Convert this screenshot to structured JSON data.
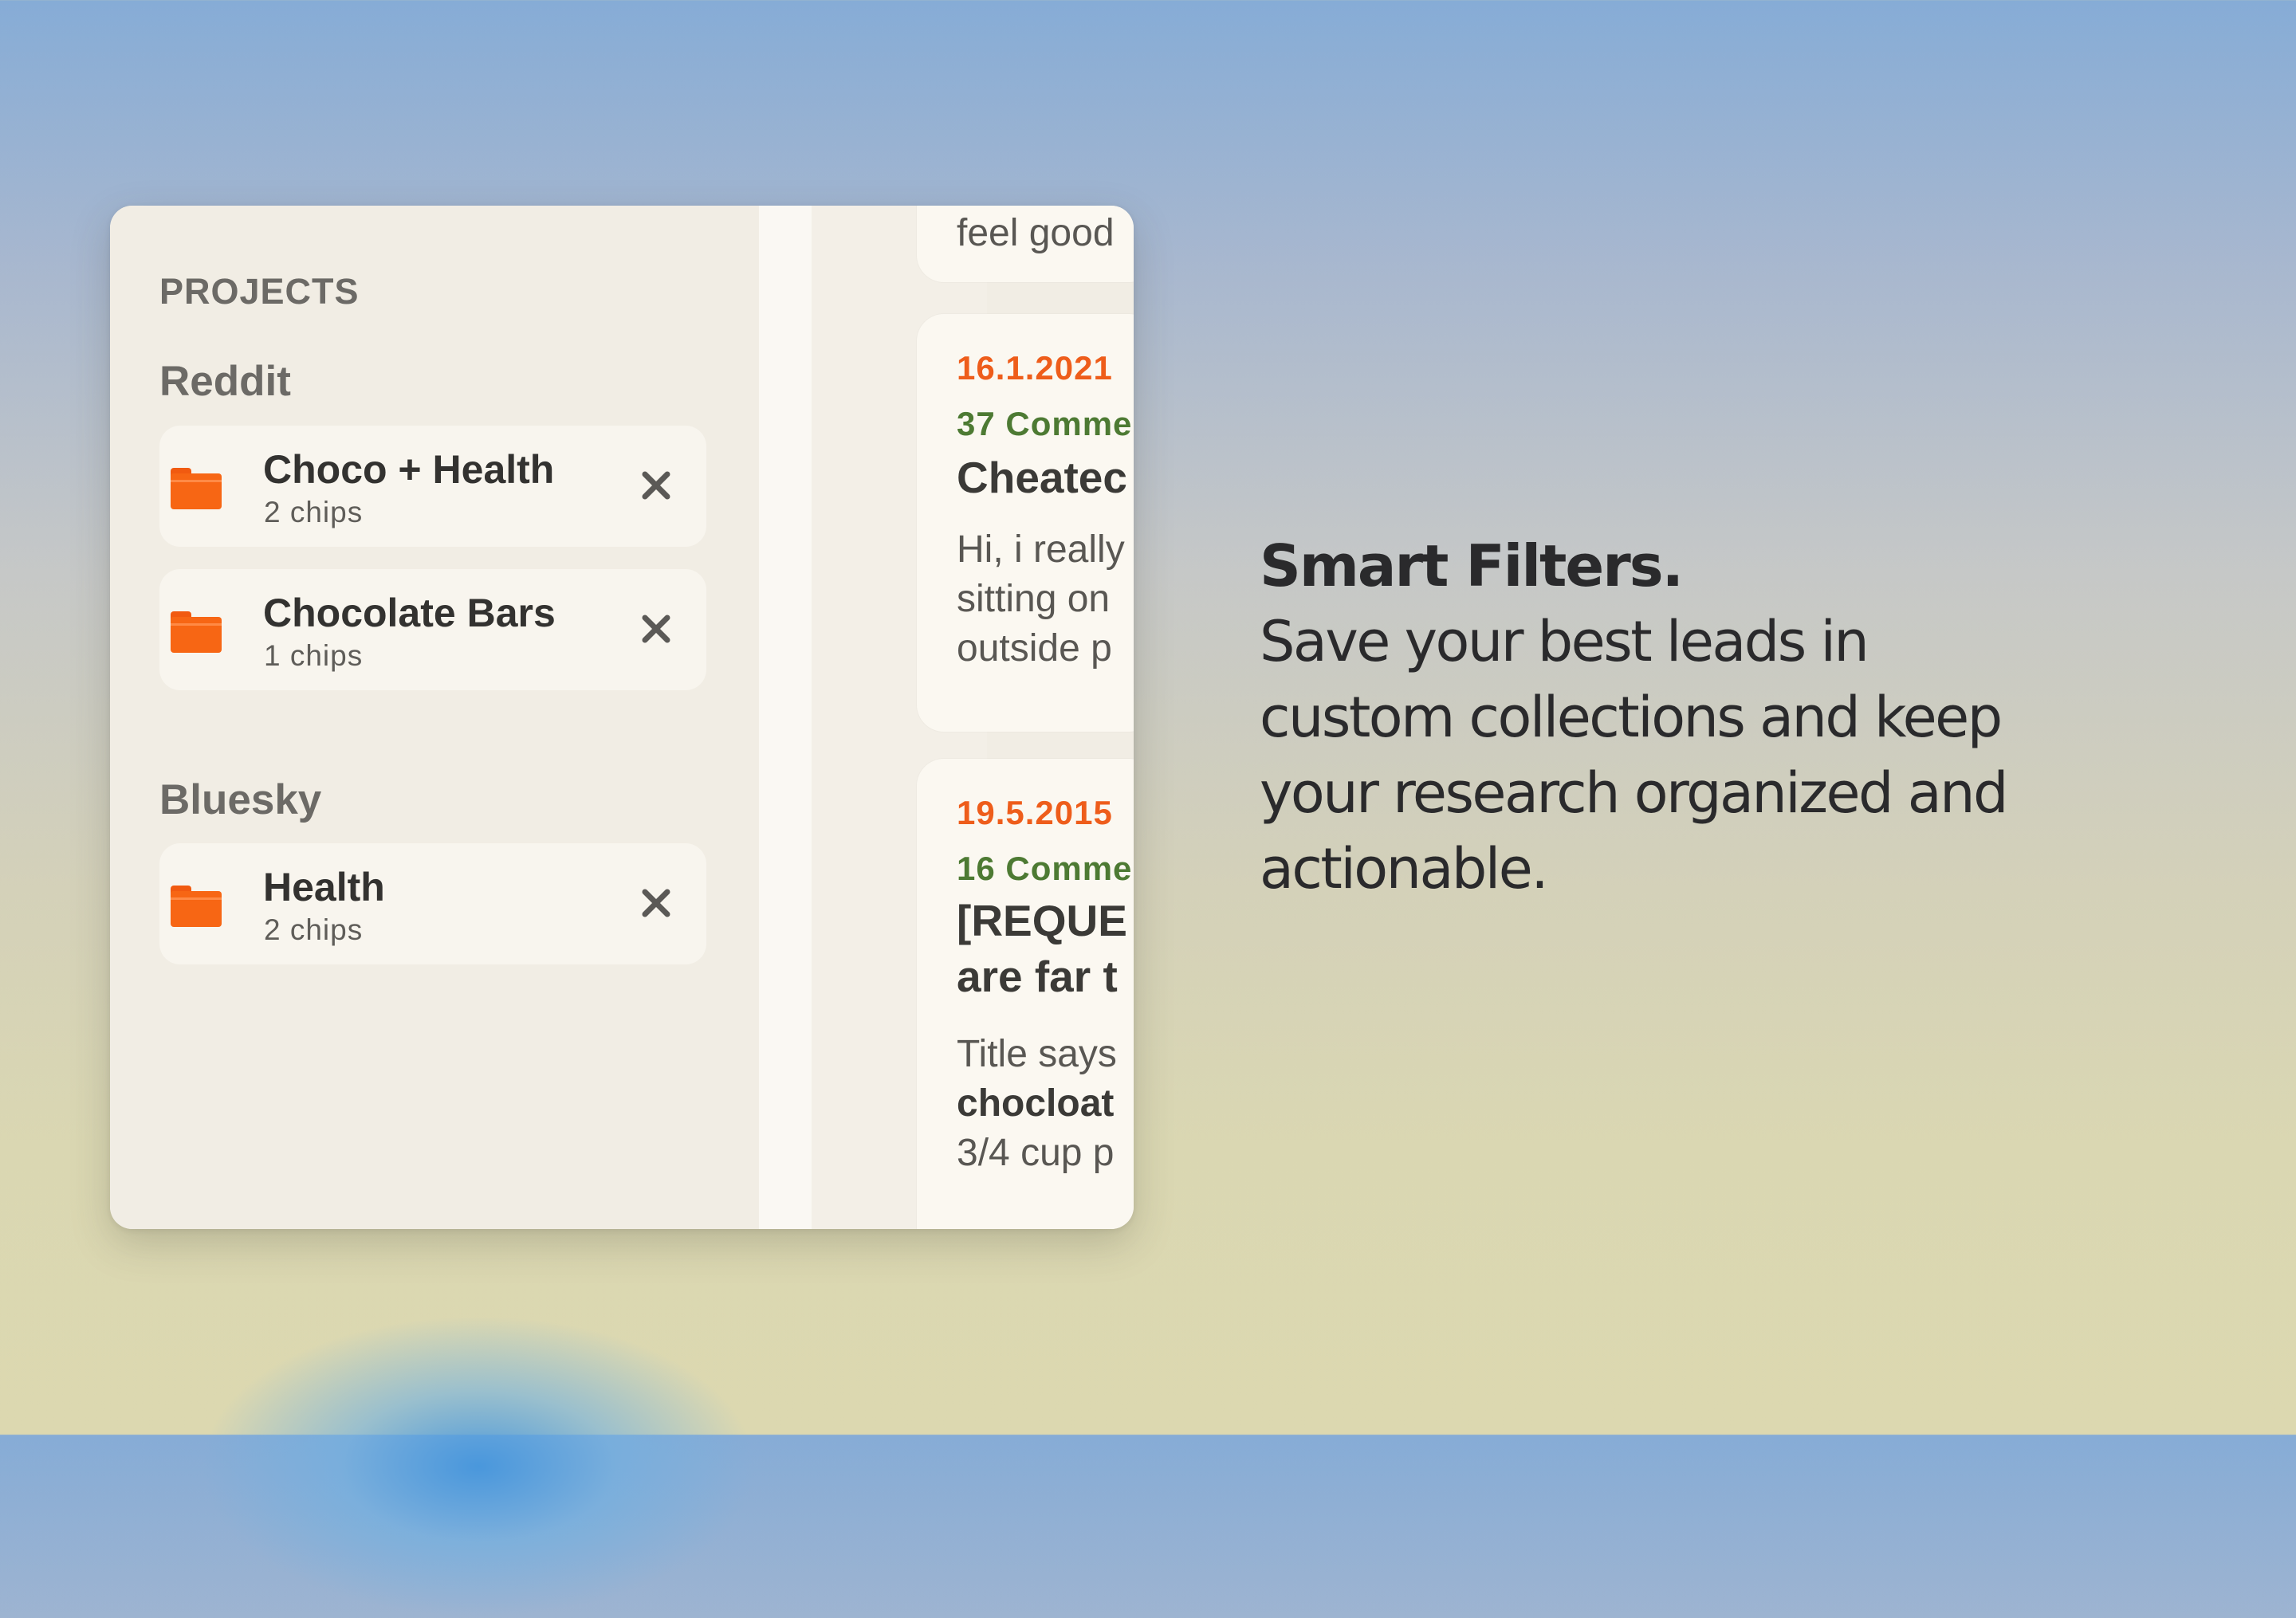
{
  "sidebar": {
    "heading": "PROJECTS",
    "groups": [
      {
        "title": "Reddit",
        "items": [
          {
            "name": "Choco + Health",
            "count": "2 chips",
            "icon": "folder-icon",
            "remove_icon": "close-icon"
          },
          {
            "name": "Chocolate Bars",
            "count": "1 chips",
            "icon": "folder-icon",
            "remove_icon": "close-icon"
          }
        ]
      },
      {
        "title": "Bluesky",
        "items": [
          {
            "name": "Health",
            "count": "2 chips",
            "icon": "folder-icon",
            "remove_icon": "close-icon"
          }
        ]
      }
    ]
  },
  "feed": {
    "cards": [
      {
        "snippet_tail": "feel good"
      },
      {
        "date": "16.1.2021",
        "comments": "37 Comme",
        "title": "Cheatec",
        "snippet": [
          "Hi, i really",
          "sitting on",
          "outside p"
        ]
      },
      {
        "date": "19.5.2015",
        "comments": "16 Comme",
        "title": [
          "[REQUE",
          "are far t"
        ],
        "snippet": [
          "Title says",
          "chocloat",
          "3/4 cup p"
        ]
      }
    ]
  },
  "marketing": {
    "headline": "Smart Filters.",
    "description": "Save your best leads in custom collections and keep your research organized and actionable."
  },
  "colors": {
    "folder": "#f76614",
    "date": "#ee5d1b",
    "comments": "#4d7a33"
  }
}
